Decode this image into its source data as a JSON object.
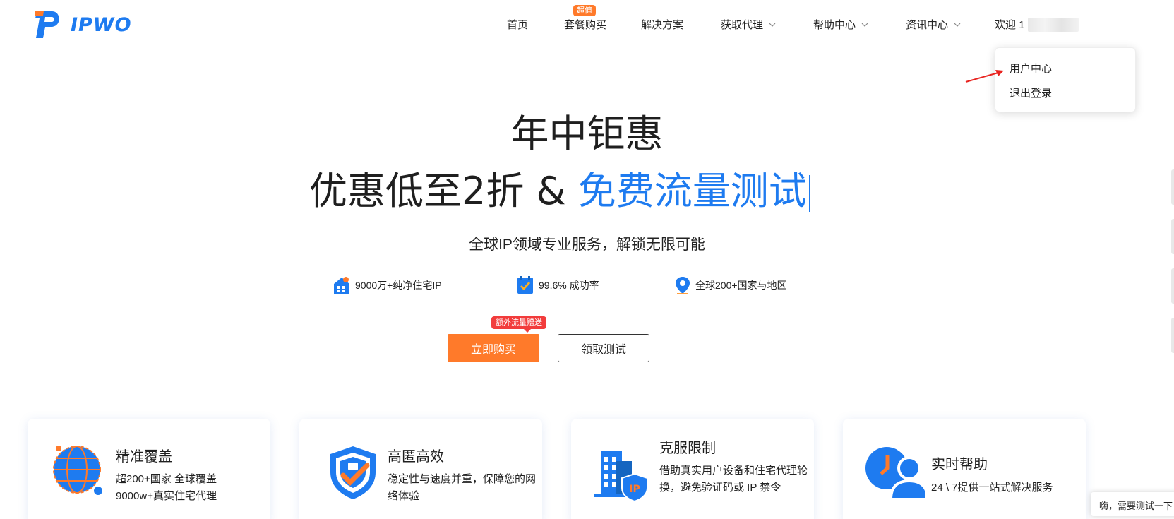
{
  "brand": {
    "name": "IPWO",
    "color": "#1e7bf0",
    "accent": "#ff7a2a"
  },
  "nav": {
    "items": [
      {
        "label": "首页"
      },
      {
        "label": "套餐购买",
        "badge": "超值"
      },
      {
        "label": "解决方案"
      },
      {
        "label": "获取代理",
        "has_dropdown": true
      },
      {
        "label": "帮助中心",
        "has_dropdown": true
      },
      {
        "label": "资讯中心",
        "has_dropdown": true
      }
    ],
    "welcome": "欢迎 1"
  },
  "user_menu": {
    "items": [
      "用户中心",
      "退出登录"
    ]
  },
  "hero": {
    "title": "年中钜惠",
    "subtitle_prefix": "优惠低至2折 & ",
    "subtitle_highlight": "免费流量测试",
    "tagline": "全球IP领域专业服务，解锁无限可能",
    "features": [
      {
        "icon": "house-icon",
        "text": "9000万+纯净住宅IP"
      },
      {
        "icon": "checklist-icon",
        "text": "99.6% 成功率"
      },
      {
        "icon": "location-pin-icon",
        "text": "全球200+国家与地区"
      }
    ],
    "buy_button": "立即购买",
    "buy_badge": "额外流量赠送",
    "test_button": "领取测试"
  },
  "cards": [
    {
      "title": "精准覆盖",
      "desc": "超200+国家 全球覆盖 9000w+真实住宅代理",
      "icon": "globe-icon"
    },
    {
      "title": "高匿高效",
      "desc": "稳定性与速度并重，保障您的网络体验",
      "icon": "shield-icon"
    },
    {
      "title": "克服限制",
      "desc": "借助真实用户设备和住宅代理轮换，避免验证码或 IP 禁令",
      "icon": "building-ip-icon"
    },
    {
      "title": "实时帮助",
      "desc": "24 \\ 7提供一站式解决服务",
      "icon": "support-icon"
    }
  ],
  "chat_tip": "嗨，需要测试一下"
}
